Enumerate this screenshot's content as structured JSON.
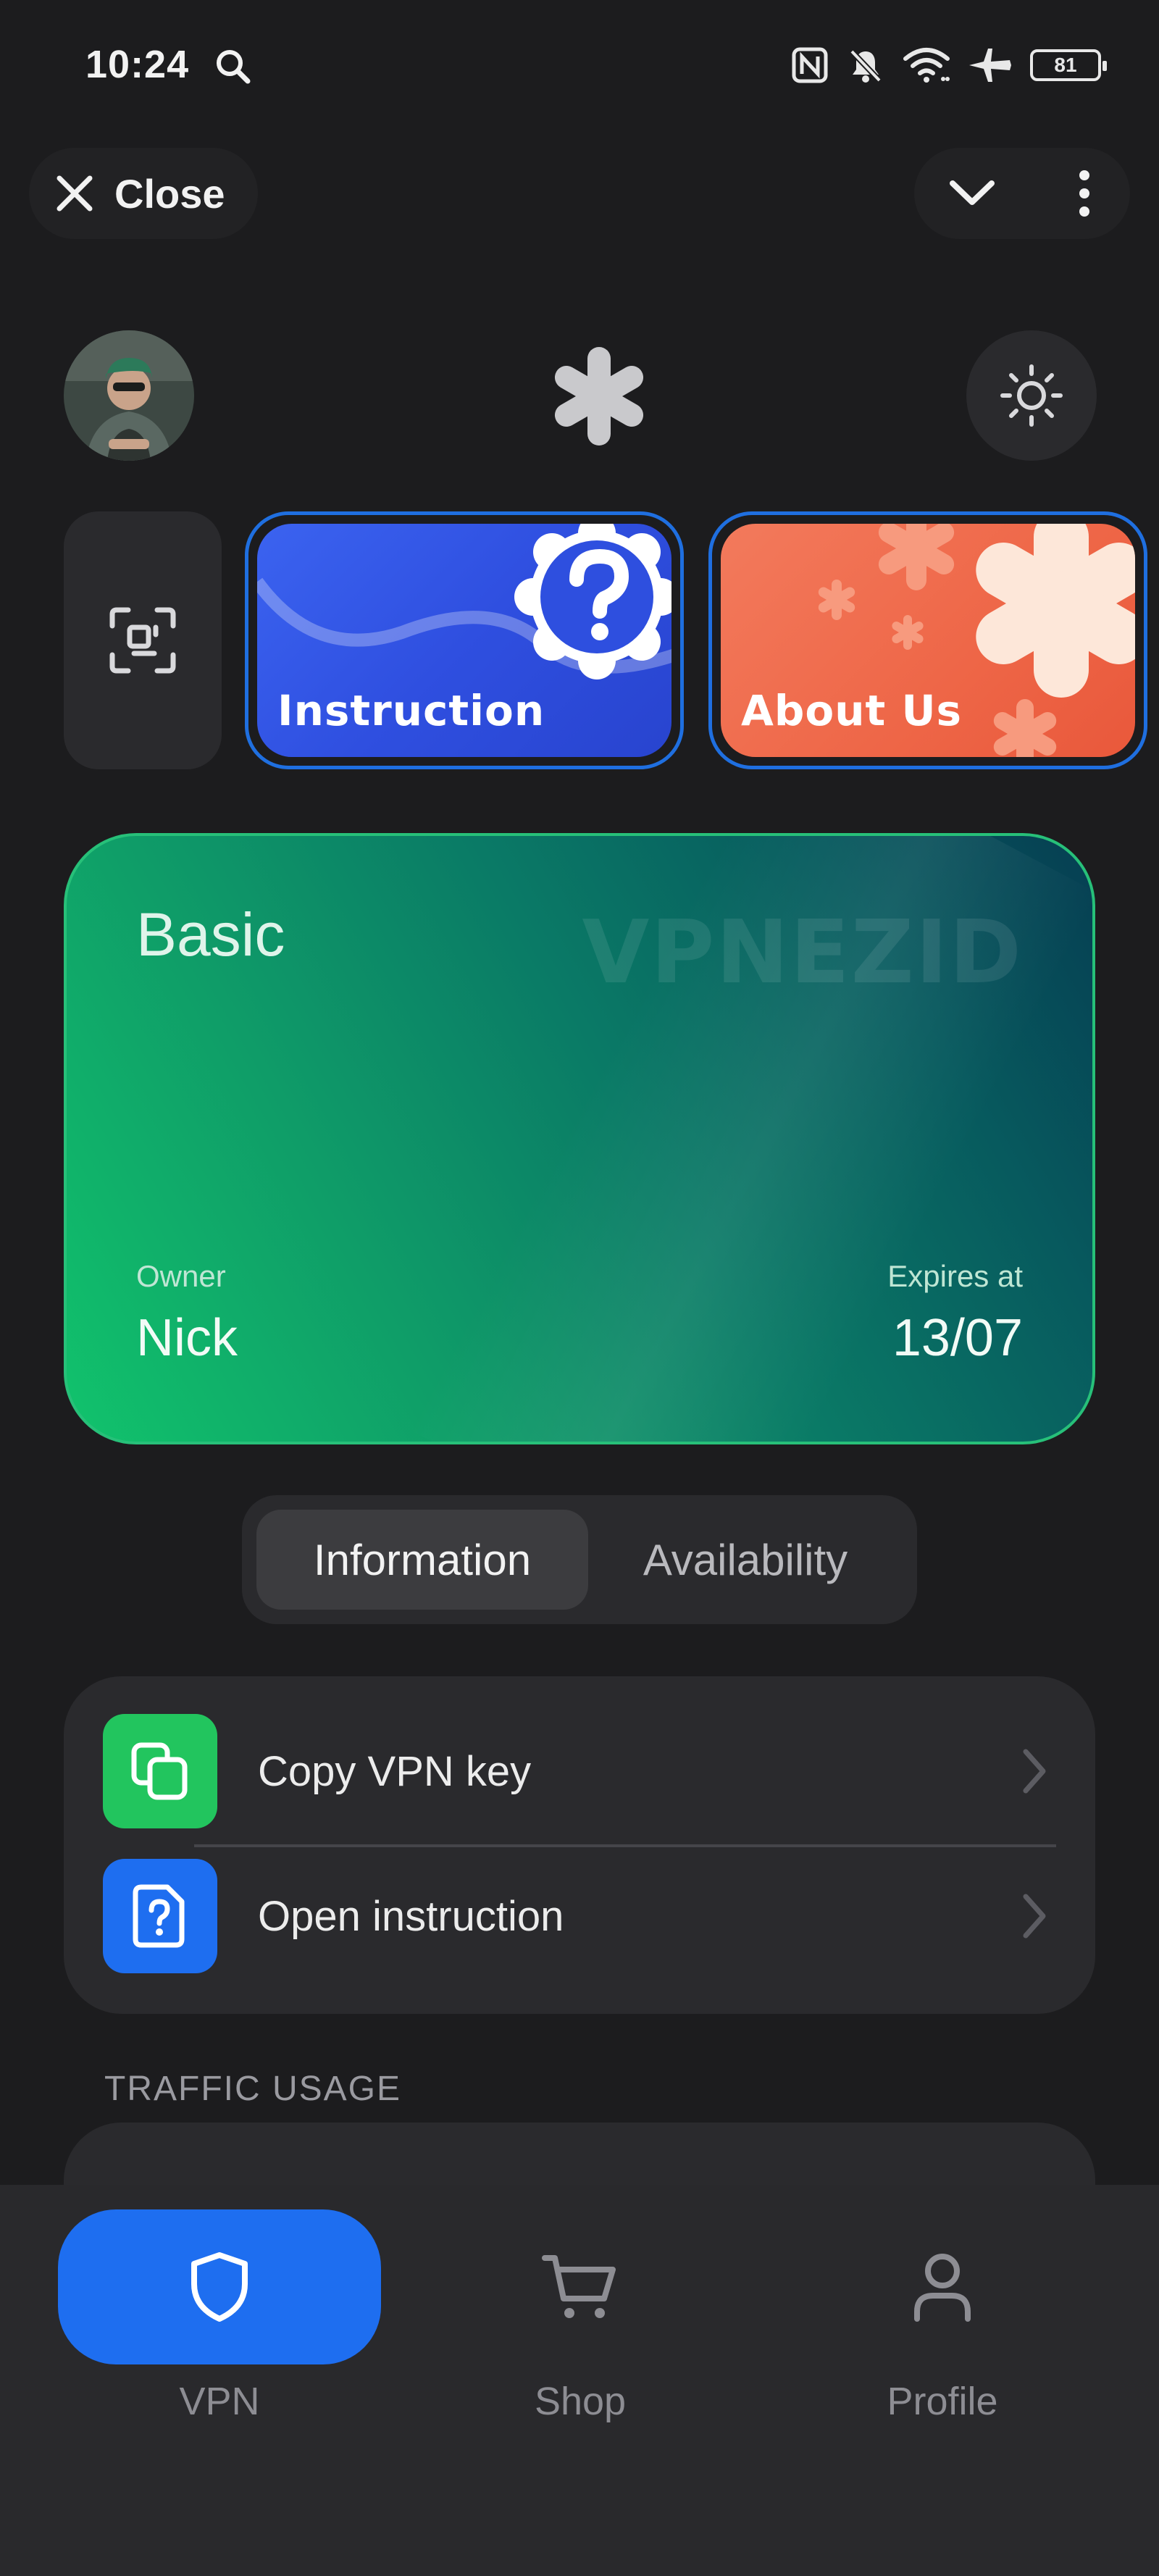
{
  "status_bar": {
    "time": "10:24",
    "battery": "81",
    "icons": [
      "search-icon",
      "nfc-icon",
      "muted-bell-icon",
      "wifi-icon",
      "airplane-icon",
      "battery-icon"
    ]
  },
  "top_bar": {
    "close_label": "Close",
    "icons": [
      "close-icon",
      "chevron-down-icon",
      "more-vertical-icon"
    ]
  },
  "header": {
    "icons": [
      "avatar",
      "asterisk-logo-icon",
      "sun-icon"
    ]
  },
  "widgets": {
    "scan_icon": "scan-qr-icon",
    "cards": [
      {
        "label": "Instruction",
        "icon": "question-badge-icon",
        "color": "#3358ea"
      },
      {
        "label": "About Us",
        "icon": "asterisk-icon",
        "color": "#ee6a4a"
      }
    ]
  },
  "subscription": {
    "plan": "Basic",
    "brand": "VPNEZID",
    "owner_label": "Owner",
    "owner": "Nick",
    "expires_label": "Expires at",
    "expires": "13/07",
    "gradient": [
      "#11c36c",
      "#063e52"
    ]
  },
  "tabs": {
    "items": [
      "Information",
      "Availability"
    ],
    "selected": "Information"
  },
  "actions": [
    {
      "label": "Copy VPN key",
      "icon": "copy-icon",
      "color": "#22c55e"
    },
    {
      "label": "Open instruction",
      "icon": "help-document-icon",
      "color": "#1e6ef0"
    }
  ],
  "traffic": {
    "header": "TRAFFIC USAGE"
  },
  "bottom_nav": {
    "items": [
      {
        "label": "VPN",
        "icon": "shield-icon",
        "active": true
      },
      {
        "label": "Shop",
        "icon": "cart-icon",
        "active": false
      },
      {
        "label": "Profile",
        "icon": "user-icon",
        "active": false
      }
    ],
    "accent": "#1e6ef0"
  }
}
